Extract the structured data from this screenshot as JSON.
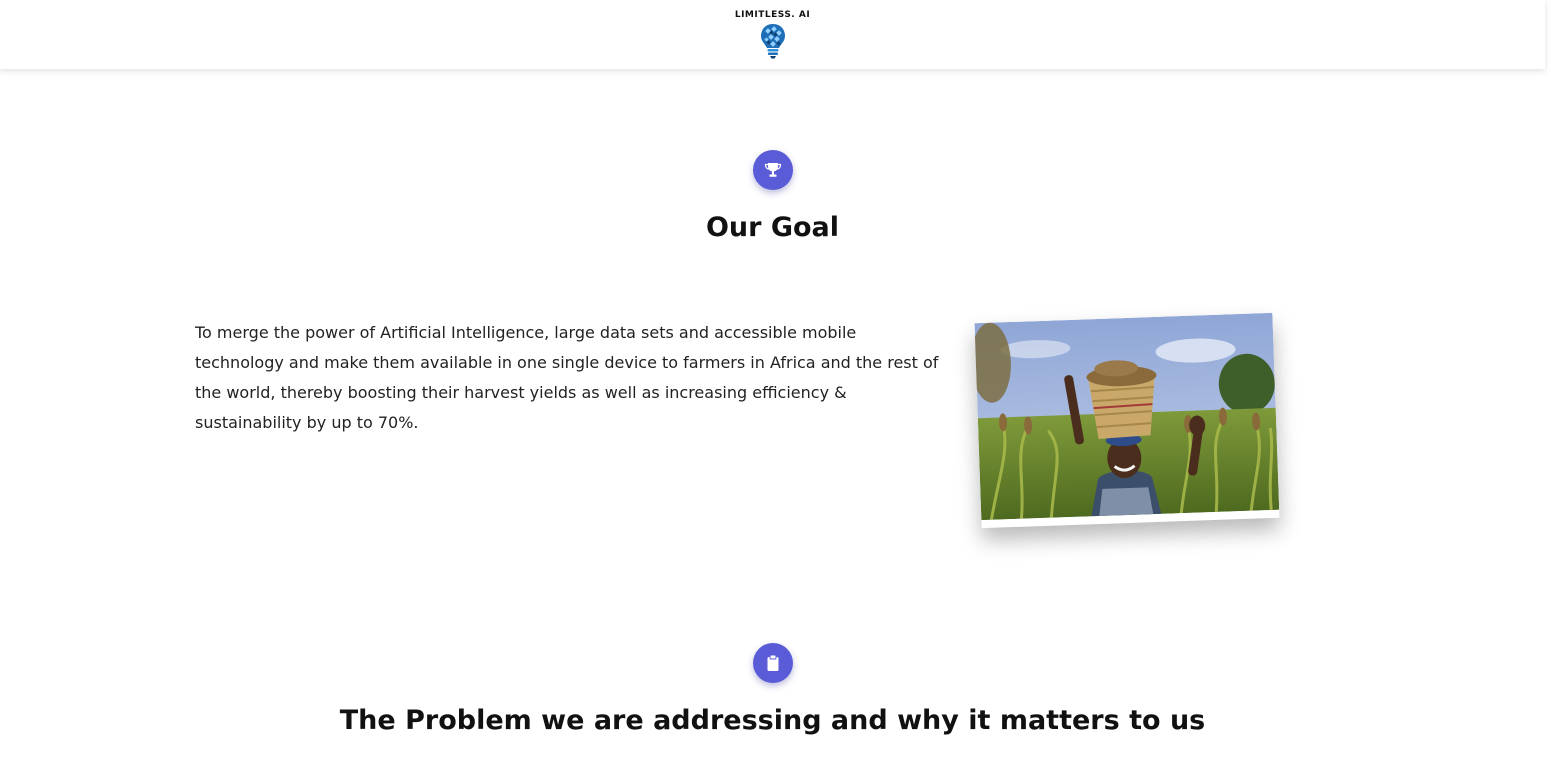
{
  "header": {
    "logo_text": "LIMITLESS. AI",
    "logo_icon": "lightbulb-icon"
  },
  "goal_section": {
    "icon": "trophy-icon",
    "title": "Our Goal",
    "body": "To merge the power of Artificial Intelligence, large data sets and accessible mobile technology and make them available in one single device to farmers in Africa and the rest of the world, thereby boosting their harvest yields as well as increasing efficiency & sustainability by up to 70%.",
    "image": "farmer-photo"
  },
  "problem_section": {
    "icon": "clipboard-icon",
    "title": "The Problem we are addressing and why it matters to us"
  },
  "colors": {
    "accent": "#5a5bd6",
    "text": "#111111",
    "logo_blue": "#2f8fd8"
  }
}
